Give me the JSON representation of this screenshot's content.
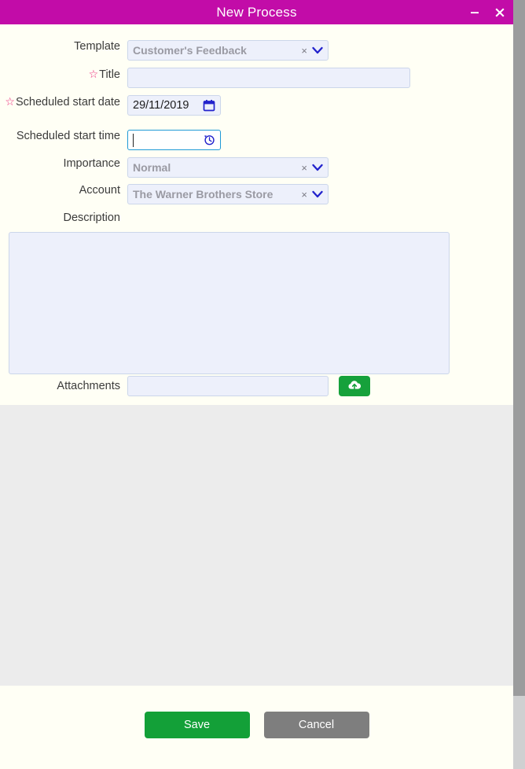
{
  "window": {
    "title": "New Process",
    "minimize_label": "minimize",
    "close_label": "close",
    "accent_color": "#c20ca8"
  },
  "form": {
    "rows": [
      {
        "label": "Template",
        "required": false,
        "type": "select",
        "value": "Customer's Feedback",
        "clear_label": "×"
      },
      {
        "label": "Title",
        "required": true,
        "type": "text",
        "value": "",
        "placeholder": ""
      },
      {
        "label": "Scheduled start date",
        "required": true,
        "type": "date",
        "value": "29/11/2019",
        "icon": "calendar-icon"
      },
      {
        "label": "Scheduled start time",
        "required": false,
        "type": "time",
        "value": "",
        "placeholder": "",
        "icon": "clock-history-icon",
        "focused": true
      },
      {
        "label": "Importance",
        "required": false,
        "type": "select",
        "value": "Normal",
        "clear_label": "×"
      },
      {
        "label": "Account",
        "required": false,
        "type": "select",
        "value": "The Warner Brothers Store",
        "clear_label": "×"
      },
      {
        "label": "Description",
        "required": false,
        "type": "textarea",
        "value": ""
      },
      {
        "label": "Attachments",
        "required": false,
        "type": "file",
        "value": "",
        "upload_icon": "cloud-upload-icon"
      }
    ]
  },
  "footer": {
    "save_label": "Save",
    "cancel_label": "Cancel",
    "save_color": "#13a038",
    "cancel_color": "#7e7e7e"
  },
  "colors": {
    "form_background": "#fffff5",
    "gray_panel": "#ececec",
    "input_background": "#edf0fb",
    "input_border": "#cbd6ea",
    "focus_border": "#1f9ad6",
    "required_star": "#ec2a7b",
    "upload_green": "#16a13b"
  }
}
